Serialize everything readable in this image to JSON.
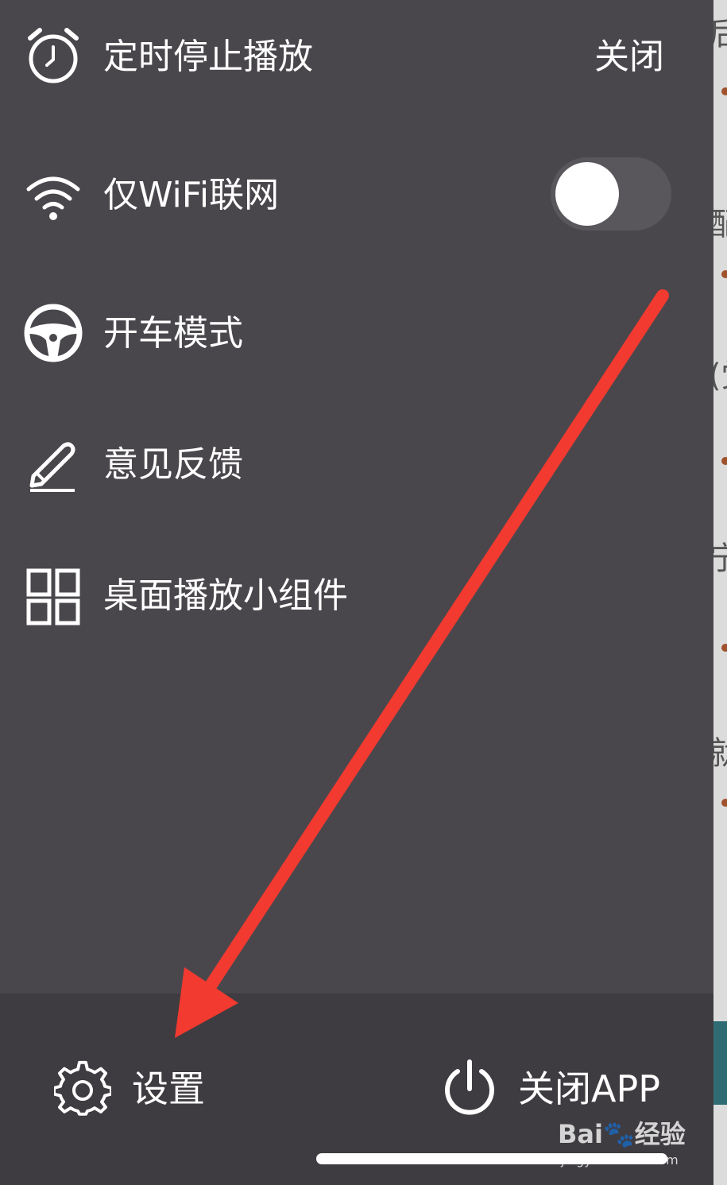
{
  "menu": {
    "items": [
      {
        "label": "定时停止播放",
        "icon": "alarm-clock-icon",
        "value": "关闭"
      },
      {
        "label": "仅WiFi联网",
        "icon": "wifi-icon",
        "toggle_on": false
      },
      {
        "label": "开车模式",
        "icon": "steering-wheel-icon"
      },
      {
        "label": "意见反馈",
        "icon": "pen-icon"
      },
      {
        "label": "桌面播放小组件",
        "icon": "widget-grid-icon"
      }
    ]
  },
  "bottom": {
    "settings_label": "设置",
    "settings_icon": "gear-icon",
    "close_app_label": "关闭APP",
    "close_app_icon": "power-icon"
  },
  "watermark": {
    "main": "Bai🐾经验",
    "sub": "jingyan.baidu.com"
  },
  "colors": {
    "drawer_bg": "#4a474c",
    "bottom_bar_bg": "#3f3c41",
    "annotation_arrow": "#f23a30"
  }
}
